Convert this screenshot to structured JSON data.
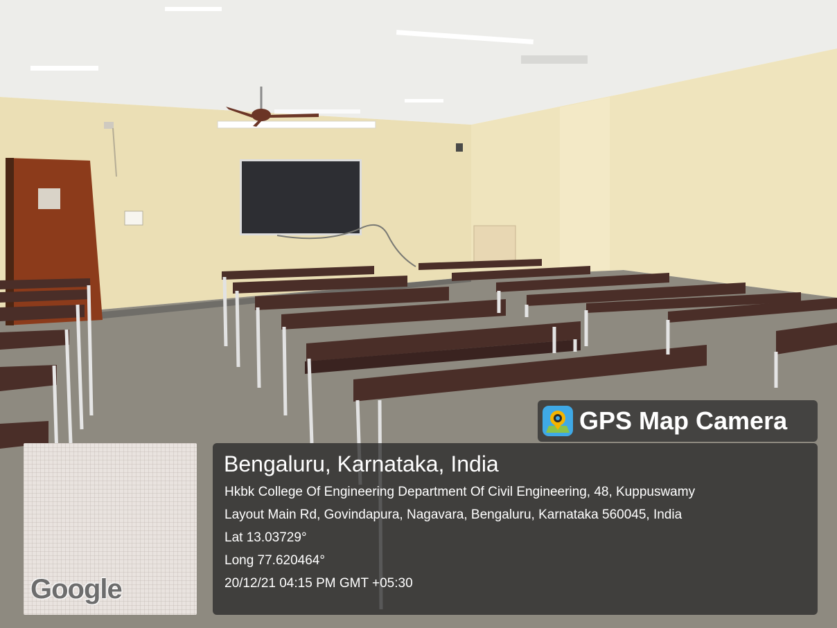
{
  "overlay": {
    "brand": {
      "icon": "map-pin-camera-icon",
      "name": "GPS Map Camera"
    },
    "map_logo": "Google",
    "location": {
      "title": "Bengaluru, Karnataka, India",
      "address_line1": "Hkbk College Of Engineering Department Of Civil Engineering, 48, Kuppuswamy",
      "address_line2": "Layout Main Rd, Govindapura, Nagavara, Bengaluru, Karnataka 560045, India",
      "lat": "Lat 13.03729°",
      "long": "Long 77.620464°",
      "datetime": "20/12/21 04:15 PM GMT +05:30"
    }
  },
  "colors": {
    "wall": "#ece0b6",
    "ceiling": "#eeeeea",
    "floor": "#8f8a80",
    "door": "#8a3a1a",
    "desk_top": "#4a2e28",
    "desk_frame": "#e6e6e6",
    "tv": "#2e2f33"
  }
}
